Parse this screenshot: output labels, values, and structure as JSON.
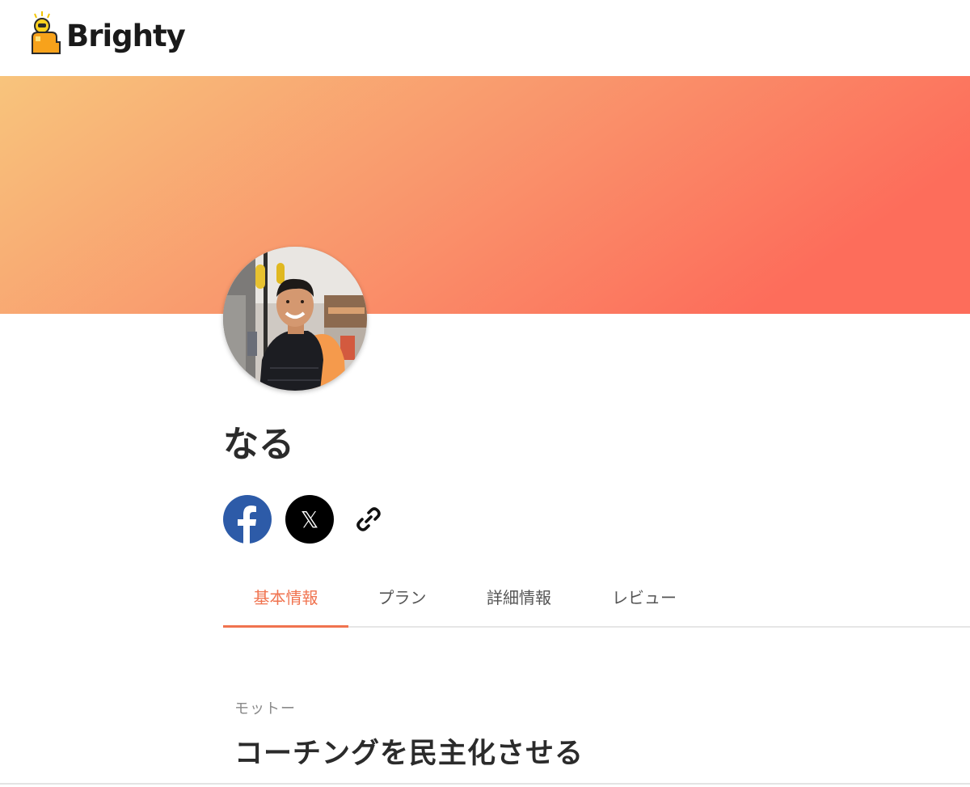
{
  "header": {
    "logo_text": "Brighty"
  },
  "colors": {
    "accent": "#f0734f",
    "banner_start": "#f8c47c",
    "banner_end": "#fd6d5b",
    "facebook": "#2d5ba8",
    "x": "#000000"
  },
  "profile": {
    "name": "なる"
  },
  "social": {
    "facebook_icon": "facebook-icon",
    "x_label": "𝕏",
    "link_icon": "link-icon"
  },
  "tabs": [
    {
      "label": "基本情報",
      "active": true
    },
    {
      "label": "プラン",
      "active": false
    },
    {
      "label": "詳細情報",
      "active": false
    },
    {
      "label": "レビュー",
      "active": false
    }
  ],
  "motto": {
    "label": "モットー",
    "text": "コーチングを民主化させる"
  }
}
